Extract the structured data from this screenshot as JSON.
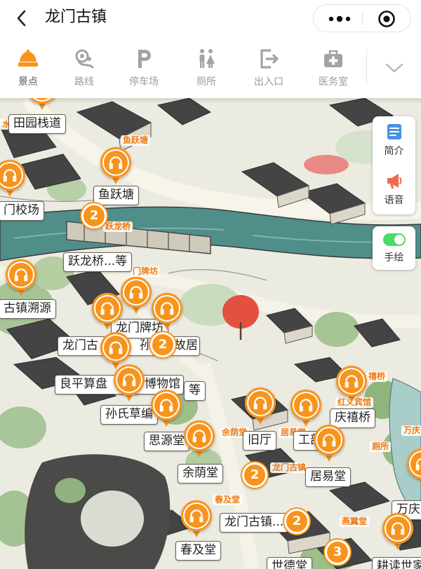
{
  "header": {
    "title": "龙门古镇",
    "back_icon": "chevron-left-icon",
    "more_icon": "more-dots-icon",
    "close_icon": "target-icon"
  },
  "tabs": [
    {
      "label": "景点",
      "icon": "attraction-icon",
      "active": true
    },
    {
      "label": "路线",
      "icon": "route-icon",
      "active": false
    },
    {
      "label": "停车场",
      "icon": "parking-icon",
      "active": false
    },
    {
      "label": "厕所",
      "icon": "toilet-icon",
      "active": false
    },
    {
      "label": "出入口",
      "icon": "exit-icon",
      "active": false
    },
    {
      "label": "医务室",
      "icon": "medical-icon",
      "active": false
    }
  ],
  "tab_expand_icon": "chevron-down-icon",
  "side_panel": {
    "intro": {
      "label": "简介",
      "icon": "document-icon"
    },
    "voice": {
      "label": "语音",
      "icon": "megaphone-icon"
    },
    "handdrawn": {
      "label": "手绘",
      "icon": "toggle-icon",
      "on": true
    }
  },
  "map": {
    "audio_pin_icon": "headphones-icon",
    "labels": [
      "田园栈道",
      "鱼跃塘",
      "门校场",
      "跃龙桥...等",
      "古镇溯源",
      "龙门牌坊",
      "龙门古",
      "孙",
      "故居",
      "良平算盘",
      "博物馆",
      "等",
      "孙氏草编",
      "思源堂",
      "旧厅",
      "工部",
      "庆禧桥",
      "余荫堂",
      "居易堂",
      "万庆",
      "龙门古镇...",
      "春及堂",
      "世德堂",
      "耕读世家"
    ],
    "tags": [
      "水",
      "鱼跃塘",
      "跃龙桥",
      "门牌坊",
      "余荫堂",
      "居易堂",
      "禧桥",
      "红义宾馆",
      "万庆",
      "厕所",
      "龙门古镇",
      "春及堂",
      "燕翼堂"
    ],
    "clusters": [
      "2",
      "2",
      "2",
      "2",
      "3"
    ]
  },
  "colors": {
    "accent": "#f7941d",
    "toggle_on": "#4cd964",
    "intro_icon": "#4a90e2",
    "river": "#508e8a",
    "tab_inactive": "#9b9b9b"
  }
}
